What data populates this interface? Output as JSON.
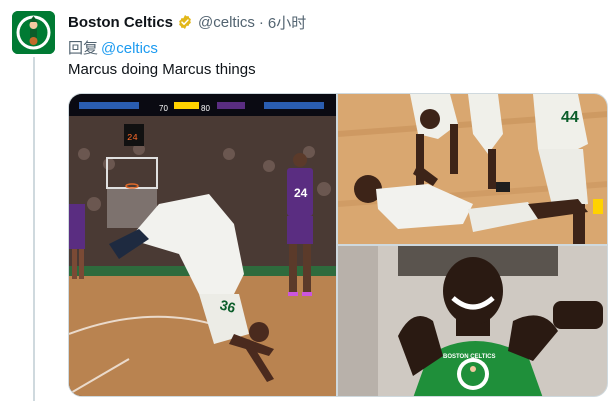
{
  "tweet": {
    "author_name": "Boston Celtics",
    "handle": "@celtics",
    "separator": "·",
    "time": "6小时",
    "reply_prefix": "回复",
    "reply_to": "@celtics",
    "text": "Marcus doing Marcus things"
  },
  "media": {
    "photo1": {
      "scoreboard_a": "70",
      "scoreboard_b": "80",
      "shot_clock": "24",
      "jersey_main": "36",
      "jersey_opponent": "24"
    },
    "photo2": {
      "jersey_number": "44"
    },
    "photo3": {
      "shirt_text": "BOSTON CELTICS"
    }
  },
  "colors": {
    "celtics_green": "#007a33",
    "verified_gold": "#e2b719",
    "link_blue": "#1d9bf0",
    "kings_purple": "#5a2d81"
  },
  "icons": [
    "celtics-logo-icon",
    "verified-badge-icon"
  ]
}
